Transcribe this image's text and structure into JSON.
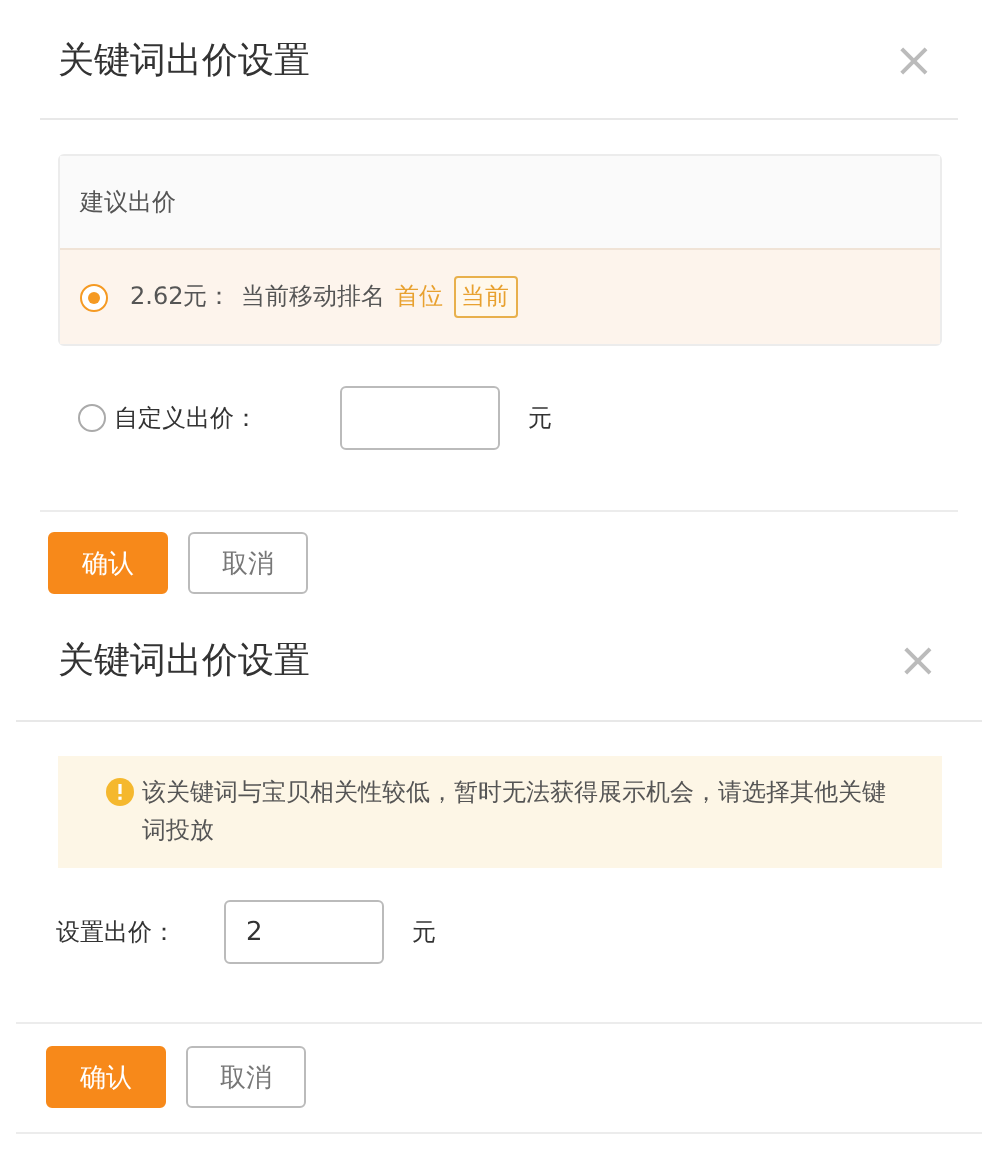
{
  "dialogs": [
    {
      "kind": "bid_options",
      "title": "关键词出价设置",
      "close": "×",
      "suggestion": {
        "heading": "建议出价",
        "option": {
          "selected": true,
          "price": "2.62元：",
          "rank_label": "当前移动排名",
          "rank": "首位",
          "tag": "当前"
        }
      },
      "custom": {
        "selected": false,
        "label": "自定义出价：",
        "unit": "元"
      },
      "buttons": [
        {
          "kind": "primary",
          "label": "确认"
        },
        {
          "kind": "secondary",
          "label": "取消"
        }
      ]
    },
    {
      "kind": "warning",
      "title": "关键词出价设置",
      "close": "×",
      "warning": "该关键词与宝贝相关性较低，暂时无法获得展示机会，请选择其他关键词投放",
      "field": {
        "label": "设置出价：",
        "value": "2",
        "unit": "元"
      },
      "buttons": [
        {
          "kind": "primary",
          "label": "确认"
        },
        {
          "kind": "secondary",
          "label": "取消"
        }
      ]
    }
  ]
}
